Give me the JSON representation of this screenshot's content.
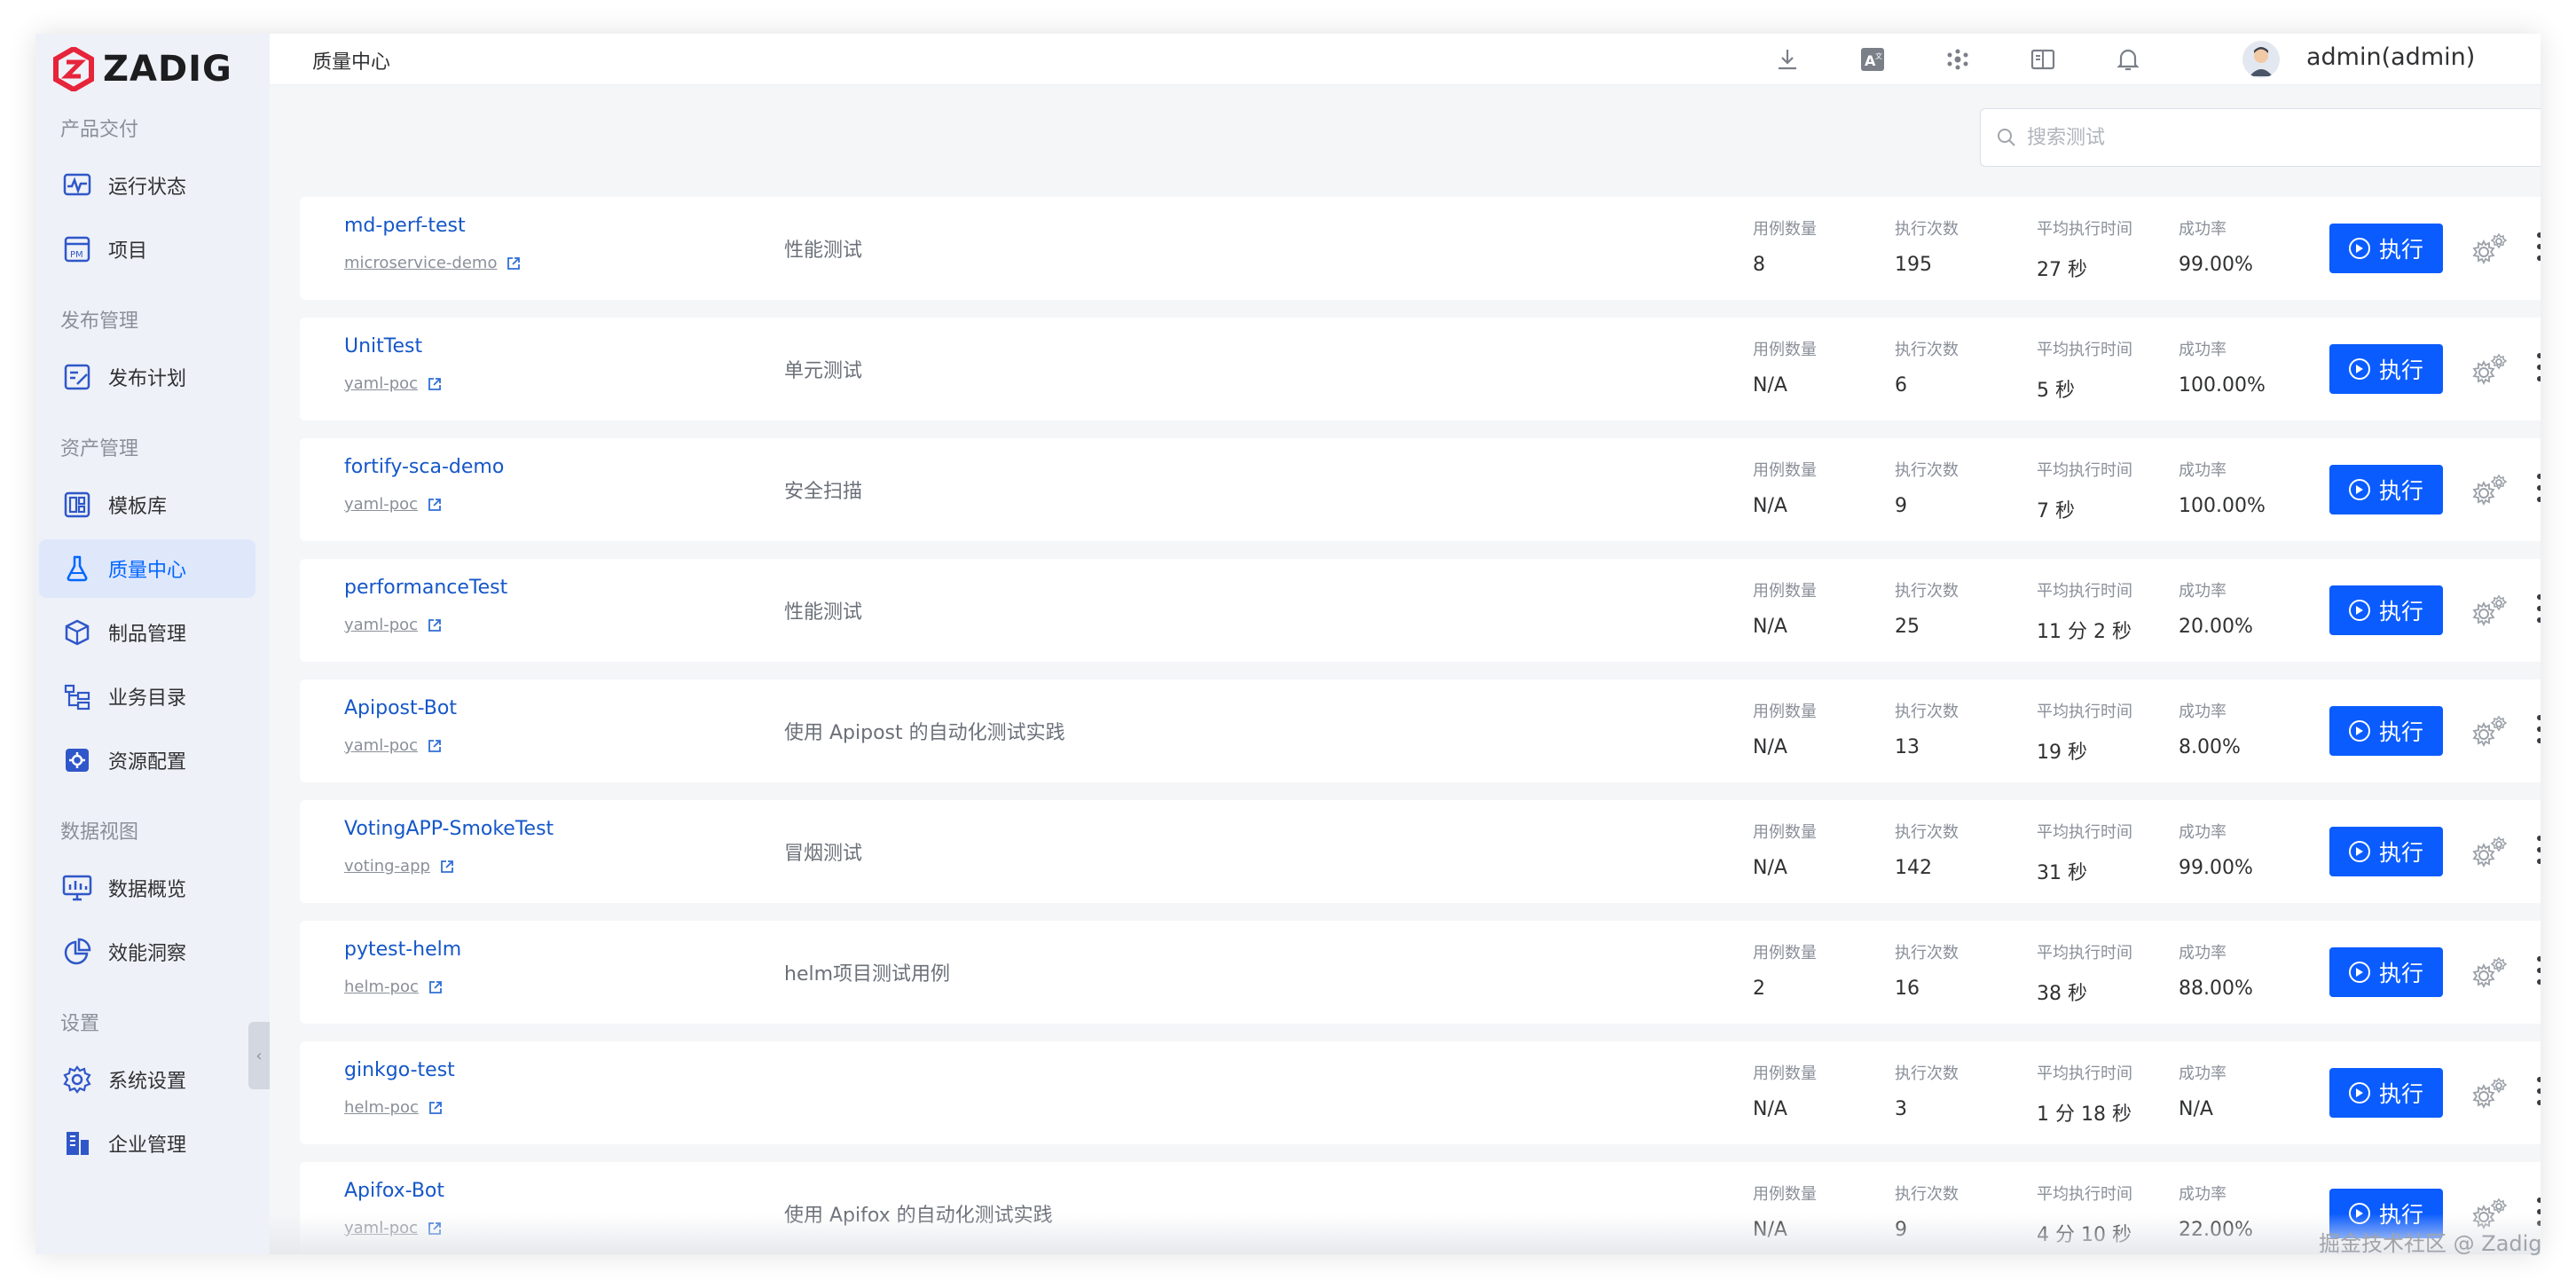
{
  "app": {
    "logo_text": "ZADIG",
    "brand_color": "#e6243a",
    "accent_color": "#0a5cff"
  },
  "sidebar": {
    "groups": [
      {
        "label": "产品交付",
        "items": [
          {
            "label": "运行状态",
            "icon": "pulse-monitor-icon"
          },
          {
            "label": "项目",
            "icon": "project-pm-icon"
          }
        ]
      },
      {
        "label": "发布管理",
        "items": [
          {
            "label": "发布计划",
            "icon": "release-plan-icon"
          }
        ]
      },
      {
        "label": "资产管理",
        "items": [
          {
            "label": "模板库",
            "icon": "template-library-icon"
          },
          {
            "label": "质量中心",
            "icon": "flask-icon",
            "active": true
          },
          {
            "label": "制品管理",
            "icon": "artifact-package-icon"
          },
          {
            "label": "业务目录",
            "icon": "business-catalog-icon"
          },
          {
            "label": "资源配置",
            "icon": "resource-config-icon"
          }
        ]
      },
      {
        "label": "数据视图",
        "items": [
          {
            "label": "数据概览",
            "icon": "data-overview-icon"
          },
          {
            "label": "效能洞察",
            "icon": "pie-chart-icon"
          }
        ]
      },
      {
        "label": "设置",
        "items": [
          {
            "label": "系统设置",
            "icon": "system-settings-gear-icon"
          },
          {
            "label": "企业管理",
            "icon": "enterprise-building-icon"
          }
        ]
      }
    ]
  },
  "header": {
    "title": "质量中心",
    "icons": [
      "download-icon",
      "translate-icon",
      "plugin-dots-icon",
      "docs-book-icon",
      "notification-bell-icon"
    ],
    "username": "admin(admin)"
  },
  "search": {
    "placeholder": "搜索测试",
    "value": ""
  },
  "stat_labels": {
    "cases": "用例数量",
    "runs": "执行次数",
    "avg_time": "平均执行时间",
    "success": "成功率"
  },
  "run_label": "执行",
  "tests": [
    {
      "name": "md-perf-test",
      "project": "microservice-demo",
      "desc": "性能测试",
      "cases": "8",
      "runs": "195",
      "avg_time": "27 秒",
      "success": "99.00%"
    },
    {
      "name": "UnitTest",
      "project": "yaml-poc",
      "desc": "单元测试",
      "cases": "N/A",
      "runs": "6",
      "avg_time": "5 秒",
      "success": "100.00%"
    },
    {
      "name": "fortify-sca-demo",
      "project": "yaml-poc",
      "desc": "安全扫描",
      "cases": "N/A",
      "runs": "9",
      "avg_time": "7 秒",
      "success": "100.00%"
    },
    {
      "name": "performanceTest",
      "project": "yaml-poc",
      "desc": "性能测试",
      "cases": "N/A",
      "runs": "25",
      "avg_time": "11 分 2 秒",
      "success": "20.00%"
    },
    {
      "name": "Apipost-Bot",
      "project": "yaml-poc",
      "desc": "使用 Apipost 的自动化测试实践",
      "cases": "N/A",
      "runs": "13",
      "avg_time": "19 秒",
      "success": "8.00%"
    },
    {
      "name": "VotingAPP-SmokeTest",
      "project": "voting-app",
      "desc": "冒烟测试",
      "cases": "N/A",
      "runs": "142",
      "avg_time": "31 秒",
      "success": "99.00%"
    },
    {
      "name": "pytest-helm",
      "project": "helm-poc",
      "desc": "helm项目测试用例",
      "cases": "2",
      "runs": "16",
      "avg_time": "38 秒",
      "success": "88.00%"
    },
    {
      "name": "ginkgo-test",
      "project": "helm-poc",
      "desc": "",
      "cases": "N/A",
      "runs": "3",
      "avg_time": "1 分 18 秒",
      "success": "N/A"
    },
    {
      "name": "Apifox-Bot",
      "project": "yaml-poc",
      "desc": "使用 Apifox 的自动化测试实践",
      "cases": "N/A",
      "runs": "9",
      "avg_time": "4 分 10 秒",
      "success": "22.00%"
    }
  ],
  "watermark": "掘金技术社区 @ Zadig"
}
